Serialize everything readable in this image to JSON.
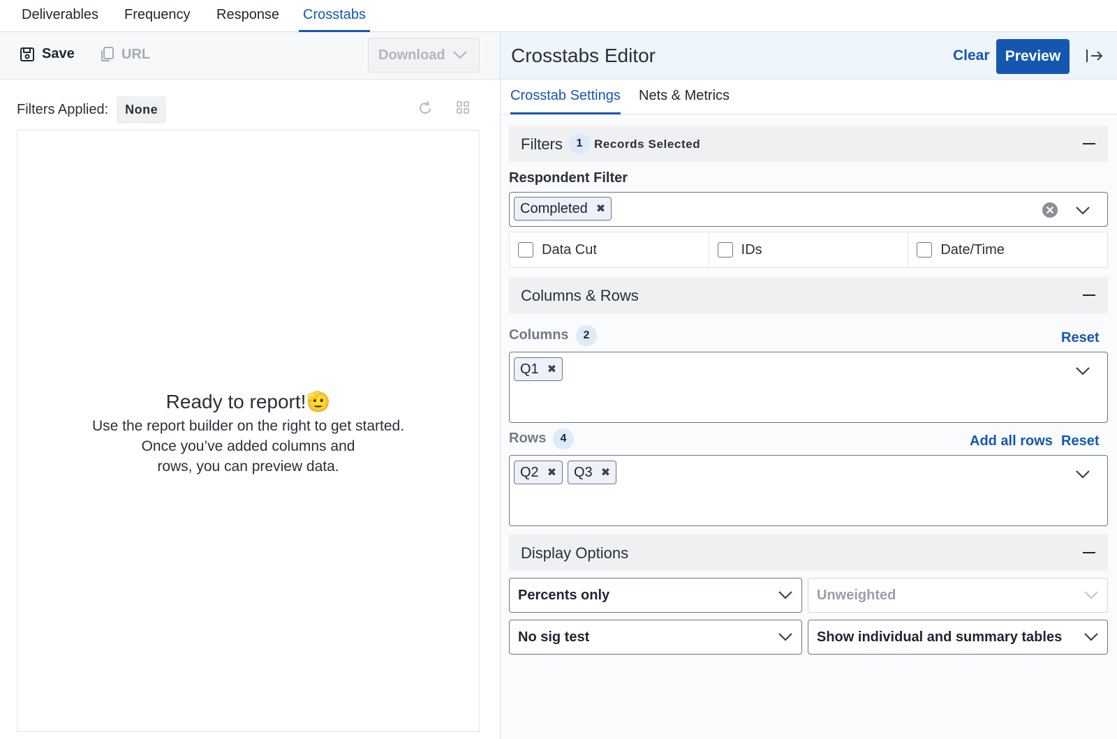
{
  "top_tabs": [
    "Deliverables",
    "Frequency",
    "Response",
    "Crosstabs"
  ],
  "active_top_tab": "Crosstabs",
  "toolbar": {
    "save_label": "Save",
    "url_label": "URL",
    "download_label": "Download"
  },
  "filters_applied": {
    "label": "Filters Applied:",
    "value": "None"
  },
  "empty_state": {
    "title": "Ready to report!",
    "emoji": "🫡",
    "line1": "Use the report builder on the right to get started.",
    "line2": "Once you’ve added columns and",
    "line3": "rows, you can preview data."
  },
  "editor": {
    "title": "Crosstabs Editor",
    "clear_label": "Clear",
    "preview_label": "Preview",
    "sub_tabs": [
      "Crosstab Settings",
      "Nets & Metrics"
    ],
    "filters": {
      "title": "Filters",
      "count": "1",
      "records_label": "Records Selected",
      "respondent_filter_label": "Respondent Filter",
      "respondent_chips": [
        "Completed"
      ],
      "checkboxes": [
        "Data Cut",
        "IDs",
        "Date/Time"
      ]
    },
    "columns_rows": {
      "title": "Columns & Rows",
      "columns_label": "Columns",
      "columns_count": "2",
      "columns_reset": "Reset",
      "column_chips": [
        "Q1"
      ],
      "rows_label": "Rows",
      "rows_count": "4",
      "rows_add_all": "Add all rows",
      "rows_reset": "Reset",
      "row_chips": [
        "Q2",
        "Q3"
      ]
    },
    "display_options": {
      "title": "Display Options",
      "percent_select": "Percents only",
      "weight_select": "Unweighted",
      "sig_select": "No sig test",
      "tables_select": "Show individual and summary tables"
    }
  },
  "colors": {
    "accent": "#1557b0",
    "header_bg": "#eef5fd",
    "section_bg": "#eef0f2"
  }
}
